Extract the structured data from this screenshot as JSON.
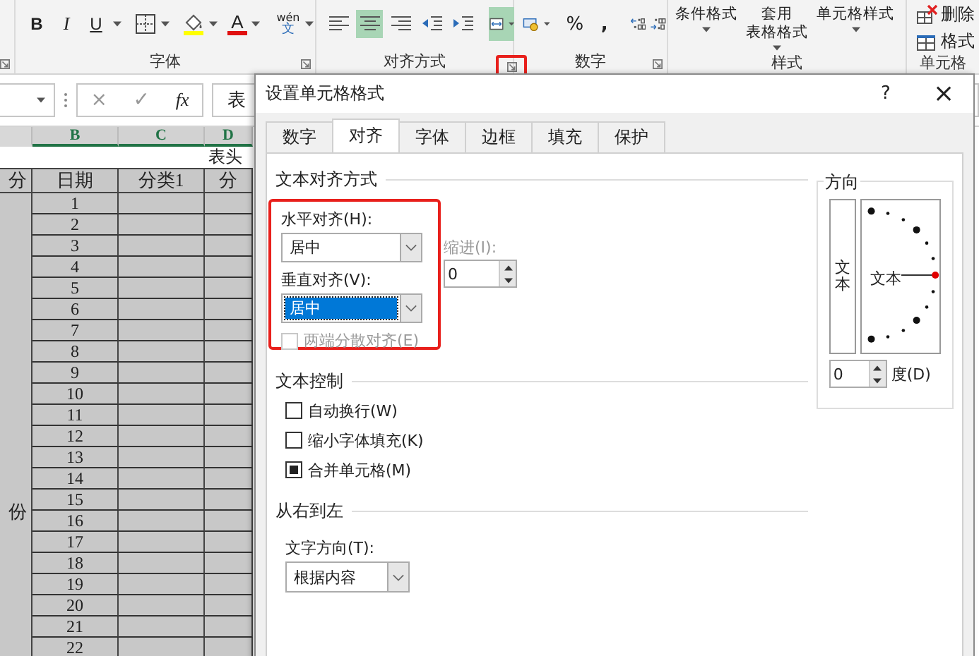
{
  "ribbon": {
    "font": {
      "label": "字体",
      "bold": "B",
      "italic": "I",
      "underline": "U",
      "font_color": "A",
      "phonetic_top": "wén",
      "phonetic_bottom": "文"
    },
    "alignment": {
      "label": "对齐方式",
      "buttons": [
        {
          "selected": false
        },
        {
          "selected": true
        },
        {
          "selected": false
        },
        {
          "selected": false
        },
        {
          "selected": false
        }
      ],
      "merge_selected": true,
      "launcher_highlighted": true
    },
    "number": {
      "label": "数字",
      "percent": "%",
      "comma": ","
    },
    "styles": {
      "label": "样式",
      "items": [
        {
          "lines": [
            "条件格式"
          ]
        },
        {
          "lines": [
            "套用",
            "表格格式"
          ]
        },
        {
          "lines": [
            "单元格样式"
          ]
        }
      ]
    },
    "cells": {
      "label": "单元格",
      "items": [
        "删除",
        "格式"
      ]
    }
  },
  "formula_bar": {
    "cancel": "×",
    "enter": "✓",
    "fx": "fx",
    "content": "表"
  },
  "sheet": {
    "columns": [
      "B",
      "C",
      "D"
    ],
    "title": "表头",
    "header": [
      "分",
      "日期",
      "分类1",
      "分"
    ],
    "side_label": "份",
    "rows": [
      "1",
      "2",
      "3",
      "4",
      "5",
      "6",
      "7",
      "8",
      "9",
      "10",
      "11",
      "12",
      "13",
      "14",
      "15",
      "16",
      "17",
      "18",
      "19",
      "20",
      "21",
      "22"
    ]
  },
  "dialog": {
    "title": "设置单元格格式",
    "help": "?",
    "close": "×",
    "tabs": [
      {
        "label": "数字",
        "selected": false
      },
      {
        "label": "对齐",
        "selected": true
      },
      {
        "label": "字体",
        "selected": false
      },
      {
        "label": "边框",
        "selected": false
      },
      {
        "label": "填充",
        "selected": false
      },
      {
        "label": "保护",
        "selected": false
      }
    ],
    "alignment": {
      "title": "文本对齐方式",
      "highlighted": true,
      "horizontal": {
        "label": "水平对齐(H):",
        "value": "居中"
      },
      "vertical": {
        "label": "垂直对齐(V):",
        "value": "居中",
        "focused": true
      },
      "indent": {
        "label": "缩进(I):",
        "value": "0",
        "disabled": true
      },
      "distributed": {
        "label": "两端分散对齐(E)",
        "checked": false,
        "disabled": true
      }
    },
    "text_control": {
      "title": "文本控制",
      "options": [
        {
          "label": "自动换行(W)",
          "checked": false
        },
        {
          "label": "缩小字体填充(K)",
          "checked": false
        },
        {
          "label": "合并单元格(M)",
          "checked": true
        }
      ]
    },
    "rtl": {
      "title": "从右到左",
      "direction": {
        "label": "文字方向(T):",
        "value": "根据内容"
      }
    },
    "orientation": {
      "title": "方向",
      "vertical_text": "文本",
      "dial_text": "文本",
      "degrees": {
        "value": "0",
        "label": "度(D)"
      }
    }
  }
}
